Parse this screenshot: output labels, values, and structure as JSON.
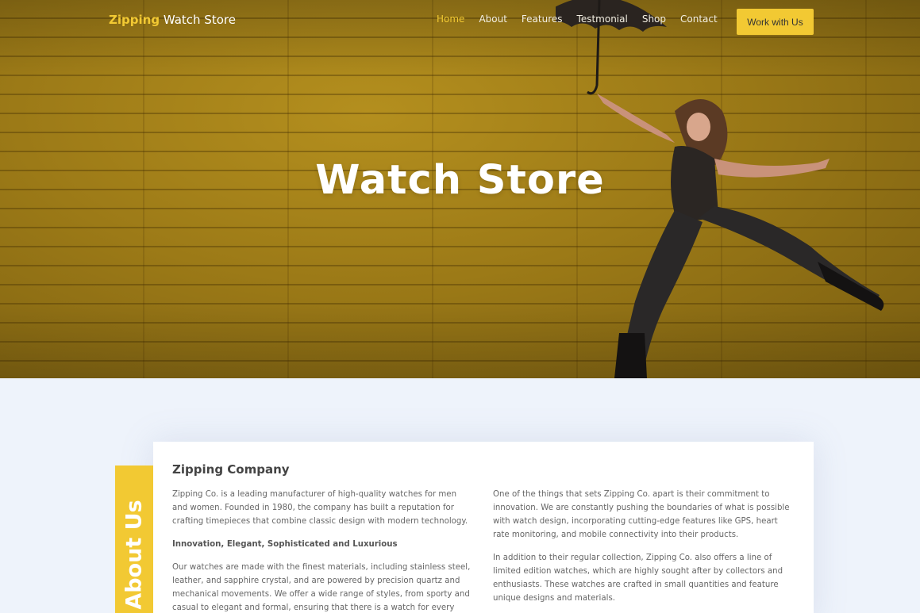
{
  "brand": {
    "accent": "Zipping",
    "rest": "Watch Store"
  },
  "nav": {
    "links": [
      "Home",
      "About",
      "Features",
      "Testmonial",
      "Shop",
      "Contact"
    ],
    "active_index": 0,
    "cta": "Work with Us"
  },
  "hero": {
    "title": "Watch Store"
  },
  "about": {
    "tab_label": "About Us",
    "heading": "Zipping Company",
    "left_paragraphs": [
      "Zipping Co. is a leading manufacturer of high-quality watches for men and women. Founded in 1980, the company has built a reputation for crafting timepieces that combine classic design with modern technology.",
      "Innovation, Elegant, Sophisticated and Luxurious",
      "Our watches are made with the finest materials, including stainless steel, leather, and sapphire crystal, and are powered by precision quartz and mechanical movements. We offer a wide range of styles, from sporty and casual to elegant and formal, ensuring that there is a watch for every"
    ],
    "right_paragraphs": [
      "One of the things that sets Zipping Co. apart is their commitment to innovation. We are constantly pushing the boundaries of what is possible with watch design, incorporating cutting-edge features like GPS, heart rate monitoring, and mobile connectivity into their products.",
      "In addition to their regular collection, Zipping Co. also offers a line of limited edition watches, which are highly sought after by collectors and enthusiasts. These watches are crafted in small quantities and feature unique designs and materials."
    ]
  },
  "colors": {
    "accent": "#f2c933",
    "hero_bg": "#9c7a17",
    "section_bg": "#eef3fb"
  },
  "icons": {
    "hero_image": "woman-with-umbrella-image"
  }
}
